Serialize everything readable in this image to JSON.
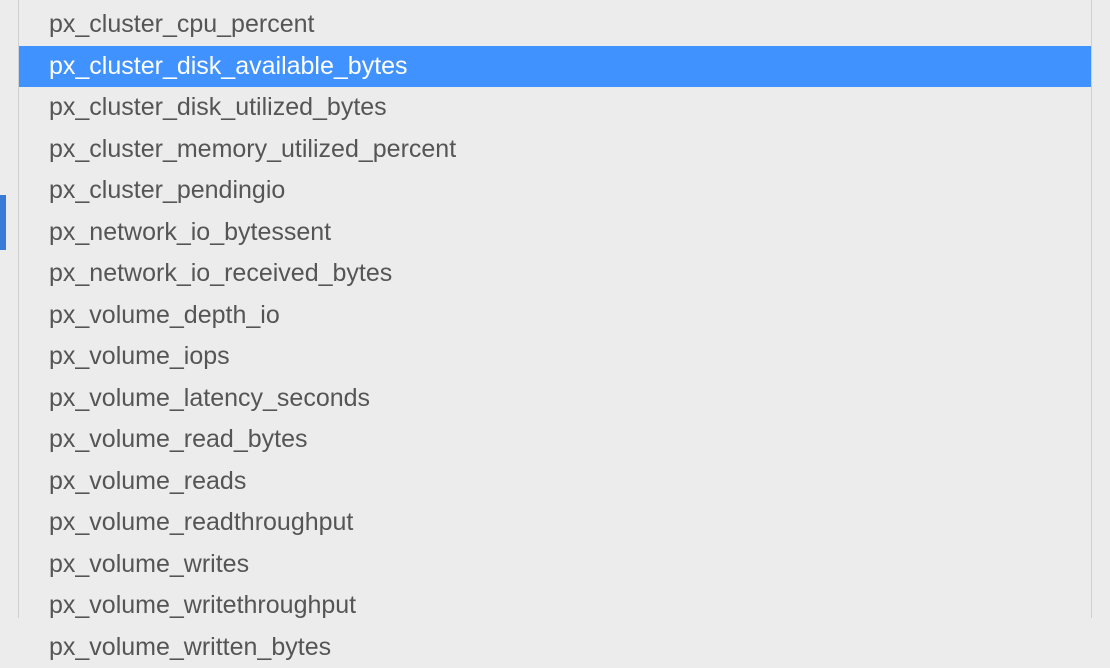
{
  "dropdown": {
    "items": [
      {
        "label": "",
        "selected": false,
        "truncated": true
      },
      {
        "label": "px_cluster_cpu_percent",
        "selected": false
      },
      {
        "label": "px_cluster_disk_available_bytes",
        "selected": true
      },
      {
        "label": "px_cluster_disk_utilized_bytes",
        "selected": false
      },
      {
        "label": "px_cluster_memory_utilized_percent",
        "selected": false
      },
      {
        "label": "px_cluster_pendingio",
        "selected": false
      },
      {
        "label": "px_network_io_bytessent",
        "selected": false
      },
      {
        "label": "px_network_io_received_bytes",
        "selected": false
      },
      {
        "label": "px_volume_depth_io",
        "selected": false
      },
      {
        "label": "px_volume_iops",
        "selected": false
      },
      {
        "label": "px_volume_latency_seconds",
        "selected": false
      },
      {
        "label": "px_volume_read_bytes",
        "selected": false
      },
      {
        "label": "px_volume_reads",
        "selected": false
      },
      {
        "label": "px_volume_readthroughput",
        "selected": false
      },
      {
        "label": "px_volume_writes",
        "selected": false
      },
      {
        "label": "px_volume_writethroughput",
        "selected": false
      },
      {
        "label": "px_volume_written_bytes",
        "selected": false
      }
    ]
  }
}
